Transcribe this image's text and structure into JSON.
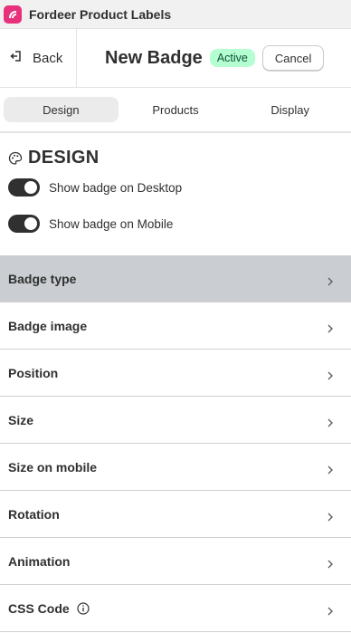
{
  "app": {
    "title": "Fordeer Product Labels"
  },
  "header": {
    "back_label": "Back",
    "page_title": "New Badge",
    "status": "Active",
    "cancel_label": "Cancel"
  },
  "tabs": [
    {
      "label": "Design",
      "active": true
    },
    {
      "label": "Products",
      "active": false
    },
    {
      "label": "Display",
      "active": false
    }
  ],
  "design": {
    "title": "DESIGN",
    "toggles": [
      {
        "label": "Show badge on Desktop",
        "on": true
      },
      {
        "label": "Show badge on Mobile",
        "on": true
      }
    ]
  },
  "settings": [
    {
      "label": "Badge type",
      "highlight": true
    },
    {
      "label": "Badge image"
    },
    {
      "label": "Position"
    },
    {
      "label": "Size"
    },
    {
      "label": "Size on mobile"
    },
    {
      "label": "Rotation"
    },
    {
      "label": "Animation"
    },
    {
      "label": "CSS Code",
      "info_icon": true
    }
  ],
  "colors": {
    "brand": "#e8317a",
    "status_bg": "#b4fed2",
    "toggle_on": "#303030",
    "highlight_row": "#cacdd2"
  }
}
